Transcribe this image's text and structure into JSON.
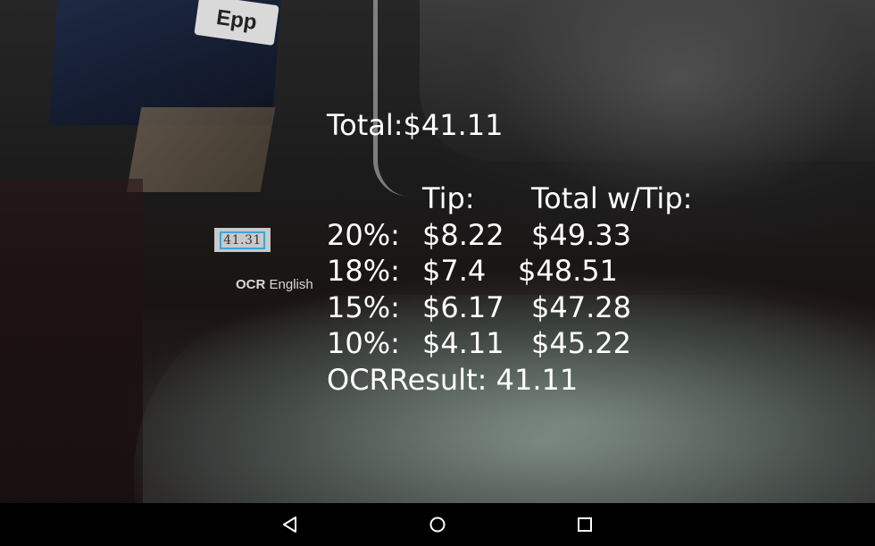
{
  "camera": {
    "label_text": "Epp"
  },
  "ocr_panel": {
    "thumbnail_text": "41.31",
    "caption_bold": "OCR",
    "caption_rest": " English"
  },
  "results": {
    "total_line": "Total:$41.11",
    "header_tip": "Tip:",
    "header_total": "Total w/Tip:",
    "rows": [
      {
        "pct": "20%:",
        "tip": "$8.22",
        "total": "$49.33"
      },
      {
        "pct": "18%:",
        "tip": "$7.4",
        "total": "$48.51"
      },
      {
        "pct": "15%:",
        "tip": "$6.17",
        "total": "$47.28"
      },
      {
        "pct": "10%:",
        "tip": "$4.11",
        "total": "$45.22"
      }
    ],
    "ocr_result": "OCRResult: 41.11"
  },
  "navbar": {
    "back_icon": "back-triangle-icon",
    "home_icon": "home-circle-icon",
    "recents_icon": "recents-square-icon"
  },
  "colors": {
    "text": "#ffffff",
    "ocr_box_border": "#3aa6d8"
  }
}
